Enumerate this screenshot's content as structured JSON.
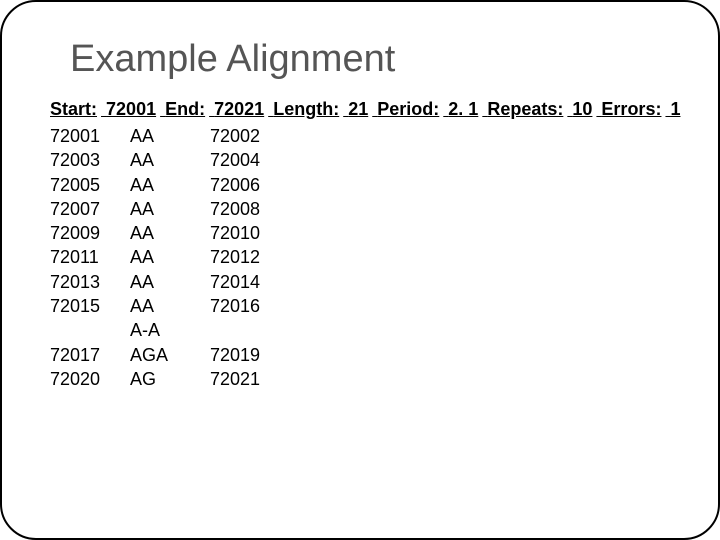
{
  "title": "Example Alignment",
  "summary": {
    "start_label": "Start:",
    "start_value": "72001",
    "end_label": "End:",
    "end_value": "72021",
    "length_label": "Length:",
    "length_value": "21",
    "period_label": "Period:",
    "period_value": "2. 1",
    "repeats_label": "Repeats:",
    "repeats_value": "10",
    "errors_label": "Errors:",
    "errors_value": "1"
  },
  "rows": [
    {
      "left": "72001",
      "seq": "AA",
      "right": "72002"
    },
    {
      "left": "72003",
      "seq": "AA",
      "right": "72004"
    },
    {
      "left": "72005",
      "seq": "AA",
      "right": "72006"
    },
    {
      "left": "72007",
      "seq": "AA",
      "right": "72008"
    },
    {
      "left": "72009",
      "seq": "AA",
      "right": "72010"
    },
    {
      "left": "72011",
      "seq": "AA",
      "right": "72012"
    },
    {
      "left": "72013",
      "seq": "AA",
      "right": "72014"
    },
    {
      "left": "72015",
      "seq": "AA",
      "right": "72016"
    },
    {
      "left": "",
      "seq": "A-A",
      "right": ""
    },
    {
      "left": "72017",
      "seq": "AGA",
      "right": "72019"
    },
    {
      "left": "72020",
      "seq": "AG",
      "right": "72021"
    }
  ]
}
